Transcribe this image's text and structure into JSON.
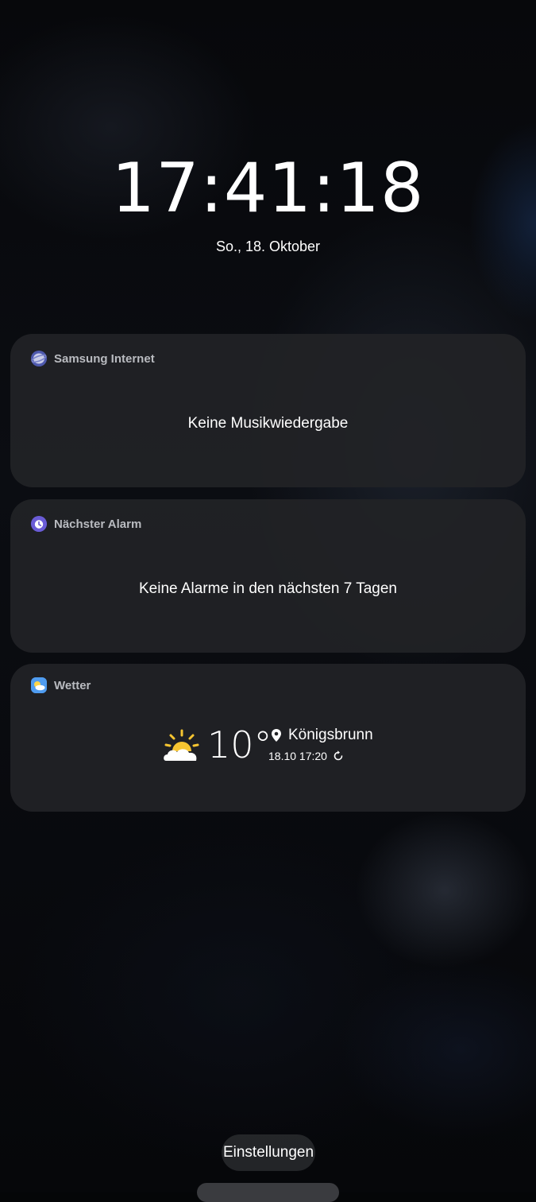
{
  "lockscreen": {
    "time": "17:41:18",
    "date": "So., 18. Oktober"
  },
  "cards": {
    "media": {
      "app_name": "Samsung Internet",
      "icon": "samsung-internet-icon",
      "message": "Keine Musikwiedergabe"
    },
    "alarm": {
      "app_name": "Nächster Alarm",
      "icon": "alarm-clock-icon",
      "message": "Keine Alarme in den nächsten 7 Tagen"
    },
    "weather": {
      "app_name": "Wetter",
      "icon": "weather-app-icon",
      "condition_icon": "partly-sunny-icon",
      "temperature": "10°",
      "location": "Königsbrunn",
      "updated": "18.10 17:20"
    }
  },
  "settings": {
    "label": "Einstellungen"
  },
  "colors": {
    "card_bg": "#222326",
    "sun": "#f7c531",
    "alarm_icon": "#6a5cd6",
    "internet_icon": "#5a63b8",
    "weather_icon": "#4f9cf0"
  }
}
